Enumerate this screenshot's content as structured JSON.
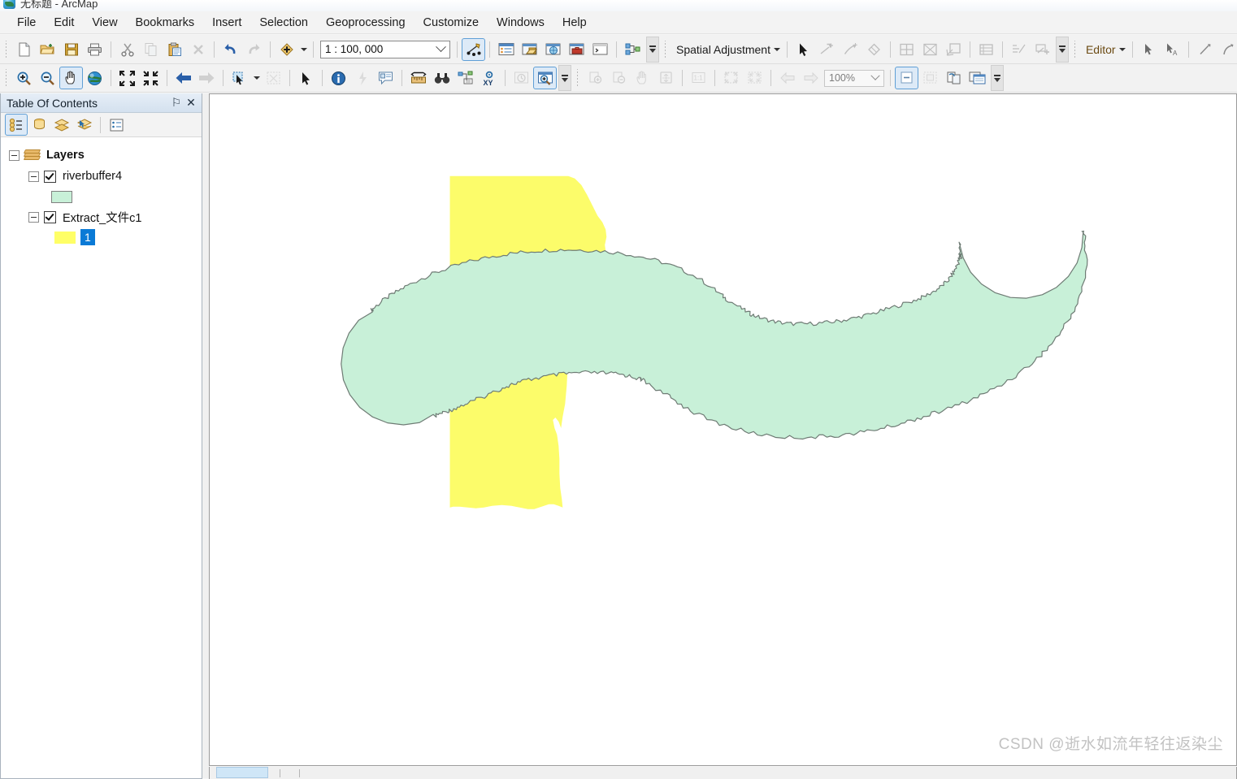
{
  "window": {
    "title": "无标题 - ArcMap",
    "app_icon": "arcmap-globe-icon"
  },
  "menubar": {
    "items": [
      {
        "label": "File",
        "name": "menu-file"
      },
      {
        "label": "Edit",
        "name": "menu-edit"
      },
      {
        "label": "View",
        "name": "menu-view"
      },
      {
        "label": "Bookmarks",
        "name": "menu-bookmarks"
      },
      {
        "label": "Insert",
        "name": "menu-insert"
      },
      {
        "label": "Selection",
        "name": "menu-selection"
      },
      {
        "label": "Geoprocessing",
        "name": "menu-geoprocessing"
      },
      {
        "label": "Customize",
        "name": "menu-customize"
      },
      {
        "label": "Windows",
        "name": "menu-windows"
      },
      {
        "label": "Help",
        "name": "menu-help"
      }
    ]
  },
  "toolbars": {
    "standard": {
      "scale": {
        "value": "1 : 100, 000",
        "placeholder": "1 : 100, 000"
      },
      "spatial_adjustment_label": "Spatial Adjustment",
      "editor_label": "Editor"
    },
    "tools": {
      "zoom_value": "100%"
    }
  },
  "table_of_contents": {
    "title": "Table Of Contents",
    "pin_glyph": "⚐",
    "close_glyph": "✕",
    "tree": {
      "root": {
        "label": "Layers",
        "expanded": true
      },
      "layers": [
        {
          "label": "riverbuffer4",
          "checked": true,
          "expanded": true,
          "symbol": {
            "fill": "#c8f0d8",
            "stroke": "#808080",
            "label": ""
          }
        },
        {
          "label": "Extract_文件c1",
          "checked": true,
          "expanded": true,
          "symbol": {
            "fill": "#ffff66",
            "stroke": "#808080",
            "label": "1",
            "selected": true
          }
        }
      ]
    }
  },
  "map": {
    "background": "#ffffff",
    "layers": [
      {
        "name": "Extract_文件c1",
        "fill": "#fcfc6a",
        "stroke": "none"
      },
      {
        "name": "riverbuffer4",
        "fill": "#c8f0d8",
        "stroke": "#6e7b74"
      }
    ]
  },
  "watermark": {
    "text": "CSDN @逝水如流年轻往返染尘",
    "color": "#c2c2c2"
  },
  "colors": {
    "accent_selection": "#0a7ad6",
    "toolbar_bg": "#f2f2f2",
    "panel_header": "#d4e1ef"
  }
}
